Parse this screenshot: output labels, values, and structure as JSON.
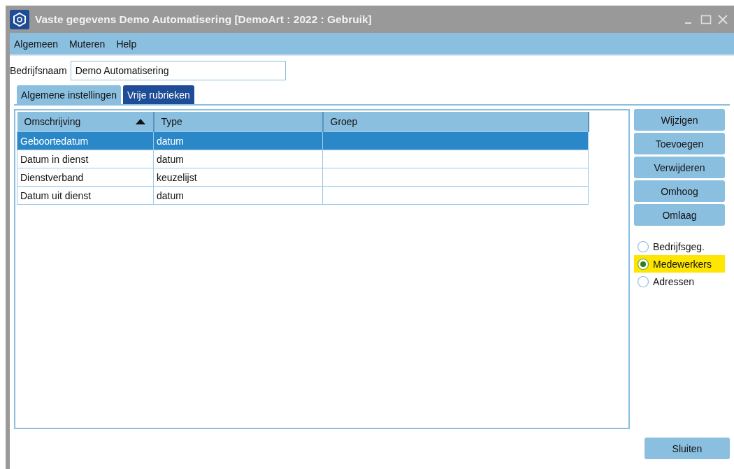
{
  "window": {
    "title": "Vaste gegevens Demo Automatisering  [DemoArt : 2022 : Gebruik]"
  },
  "menu": [
    "Algemeen",
    "Muteren",
    "Help"
  ],
  "company": {
    "label": "Bedrijfsnaam",
    "value": "Demo Automatisering"
  },
  "tabs": [
    {
      "label": "Algemene instellingen",
      "selected": false
    },
    {
      "label": "Vrije rubrieken",
      "selected": true
    }
  ],
  "table": {
    "columns": [
      {
        "label": "Omschrijving",
        "sorted": true
      },
      {
        "label": "Type"
      },
      {
        "label": "Groep"
      }
    ],
    "rows": [
      {
        "cells": [
          "Geboortedatum",
          "datum",
          ""
        ],
        "selected": true
      },
      {
        "cells": [
          "Datum in dienst",
          "datum",
          ""
        ],
        "selected": false
      },
      {
        "cells": [
          "Dienstverband",
          "keuzelijst",
          ""
        ],
        "selected": false
      },
      {
        "cells": [
          "Datum uit dienst",
          "datum",
          ""
        ],
        "selected": false
      }
    ]
  },
  "buttons": [
    {
      "label": "Wijzigen"
    },
    {
      "label": "Toevoegen"
    },
    {
      "label": "Verwijderen"
    },
    {
      "label": "Omhoog"
    },
    {
      "label": "Omlaag"
    }
  ],
  "radios": [
    {
      "label": "Bedrijfsgeg.",
      "selected": false
    },
    {
      "label": "Medewerkers",
      "selected": true
    },
    {
      "label": "Adressen",
      "selected": false
    }
  ],
  "close_button": {
    "label": "Sluiten"
  }
}
